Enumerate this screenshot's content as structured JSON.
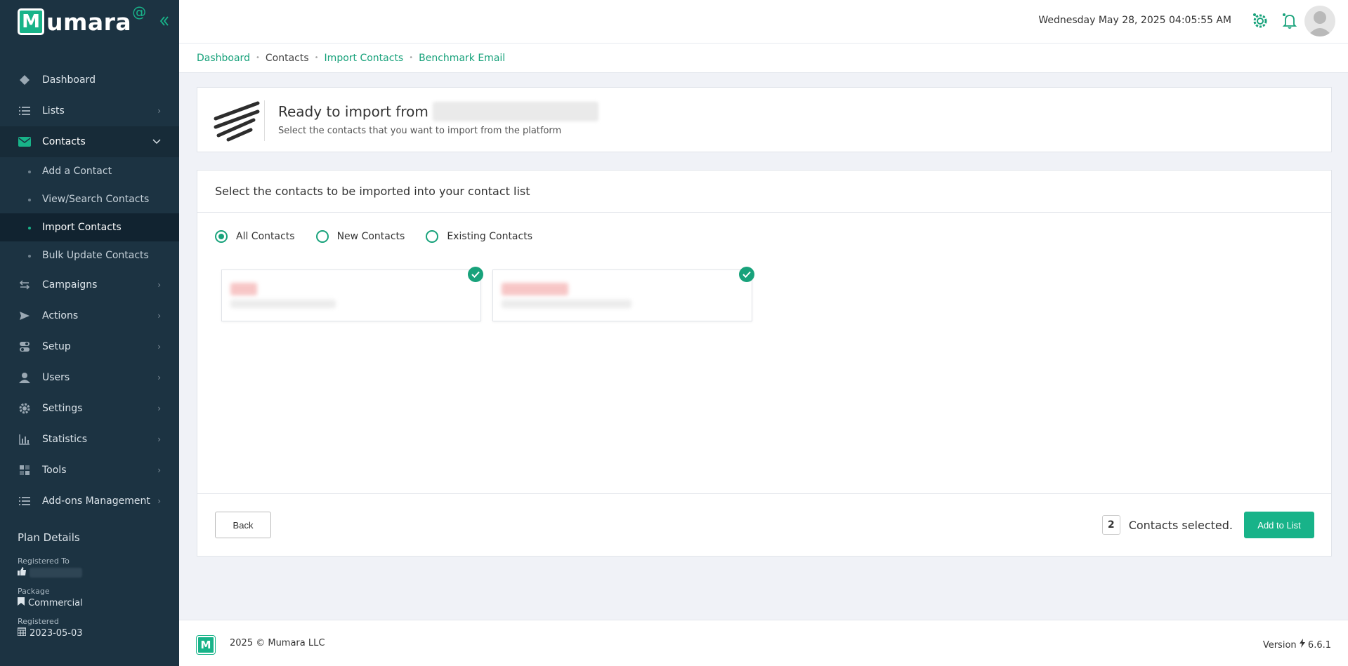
{
  "app": {
    "logo_letter": "M",
    "logo_text": "umara",
    "logo_at": "@"
  },
  "header": {
    "datetime": "Wednesday May 28, 2025 04:05:55 AM"
  },
  "sidebar": {
    "items": [
      {
        "label": "Dashboard",
        "icon": "layers-icon"
      },
      {
        "label": "Lists",
        "icon": "list-icon"
      },
      {
        "label": "Contacts",
        "icon": "envelope-icon"
      },
      {
        "label": "Campaigns",
        "icon": "arrows-icon"
      },
      {
        "label": "Actions",
        "icon": "send-icon"
      },
      {
        "label": "Setup",
        "icon": "toggle-icon"
      },
      {
        "label": "Users",
        "icon": "user-icon"
      },
      {
        "label": "Settings",
        "icon": "gear-icon"
      },
      {
        "label": "Statistics",
        "icon": "bar-chart-icon"
      },
      {
        "label": "Tools",
        "icon": "grid-icon"
      },
      {
        "label": "Add-ons Management",
        "icon": "list-icon"
      }
    ],
    "contacts_sub": [
      {
        "label": "Add a Contact"
      },
      {
        "label": "View/Search Contacts"
      },
      {
        "label": "Import Contacts"
      },
      {
        "label": "Bulk Update Contacts"
      }
    ],
    "plan": {
      "title": "Plan Details",
      "registered_to_label": "Registered To",
      "package_label": "Package",
      "package_value": "Commercial",
      "registered_label": "Registered",
      "registered_value": "2023-05-03"
    }
  },
  "breadcrumb": {
    "items": [
      {
        "label": "Dashboard"
      },
      {
        "label": "Contacts"
      },
      {
        "label": "Import Contacts"
      },
      {
        "label": "Benchmark Email"
      }
    ]
  },
  "import_header": {
    "title": "Ready to import from",
    "subtitle": "Select the contacts that you want to import from the platform"
  },
  "select_panel": {
    "title": "Select the contacts to be imported into your contact list",
    "filters": [
      {
        "label": "All Contacts",
        "checked": true
      },
      {
        "label": "New Contacts",
        "checked": false
      },
      {
        "label": "Existing Contacts",
        "checked": false
      }
    ],
    "contacts_count_selected": 2,
    "back_label": "Back",
    "selected_count": "2",
    "selected_text": "Contacts selected.",
    "add_label": "Add to List"
  },
  "footer": {
    "logo_letter": "M",
    "copyright": "2025 © Mumara LLC",
    "version_label": "Version",
    "version_value": "6.6.1"
  },
  "colors": {
    "accent": "#18b389",
    "sidebar_bg": "#1c3342"
  }
}
